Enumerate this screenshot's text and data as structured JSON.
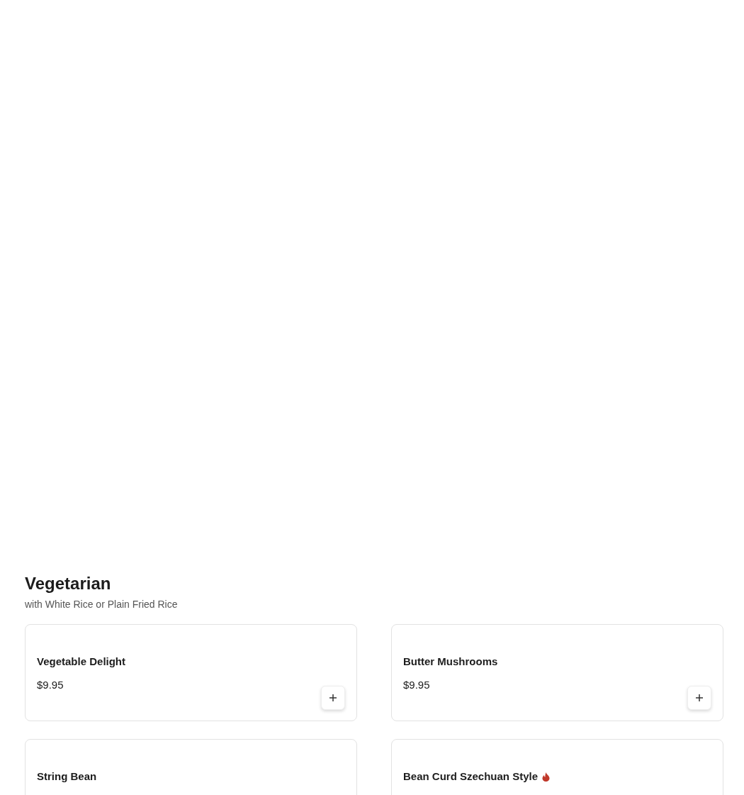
{
  "section": {
    "title": "Vegetarian",
    "subtitle": "with White Rice or Plain Fried Rice"
  },
  "items": [
    {
      "name": "Vegetable Delight",
      "price": "$9.95",
      "spicy": false
    },
    {
      "name": "Butter Mushrooms",
      "price": "$9.95",
      "spicy": false
    },
    {
      "name": "String Bean",
      "spicy": false
    },
    {
      "name": "Bean Curd Szechuan Style",
      "spicy": true
    }
  ]
}
